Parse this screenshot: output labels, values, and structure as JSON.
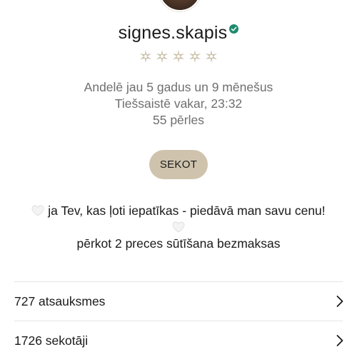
{
  "profile": {
    "username": "signes.skapis",
    "verified": true,
    "rating_stars": 5,
    "rating_color": "#cbbfa8",
    "verified_color": "#1f8a6f",
    "member_since": "Andelē jau 5 gadus un 9 mēnešus",
    "last_online": "Tiešsaistē vakar, 23:32",
    "pearls": "55 pērles"
  },
  "actions": {
    "follow_label": "SEKOT",
    "follow_color": "#cfc3ad"
  },
  "bio": {
    "line1": "ja Tev, kas ļoti iepatīkas - piedāvā man savu cenu!",
    "line2": "pērkot 2 preces sūtīšana bezmaksas",
    "heart_icon": "white-heart-icon"
  },
  "stats": {
    "reviews": "727 atsauksmes",
    "followers": "1726 sekotāji"
  }
}
